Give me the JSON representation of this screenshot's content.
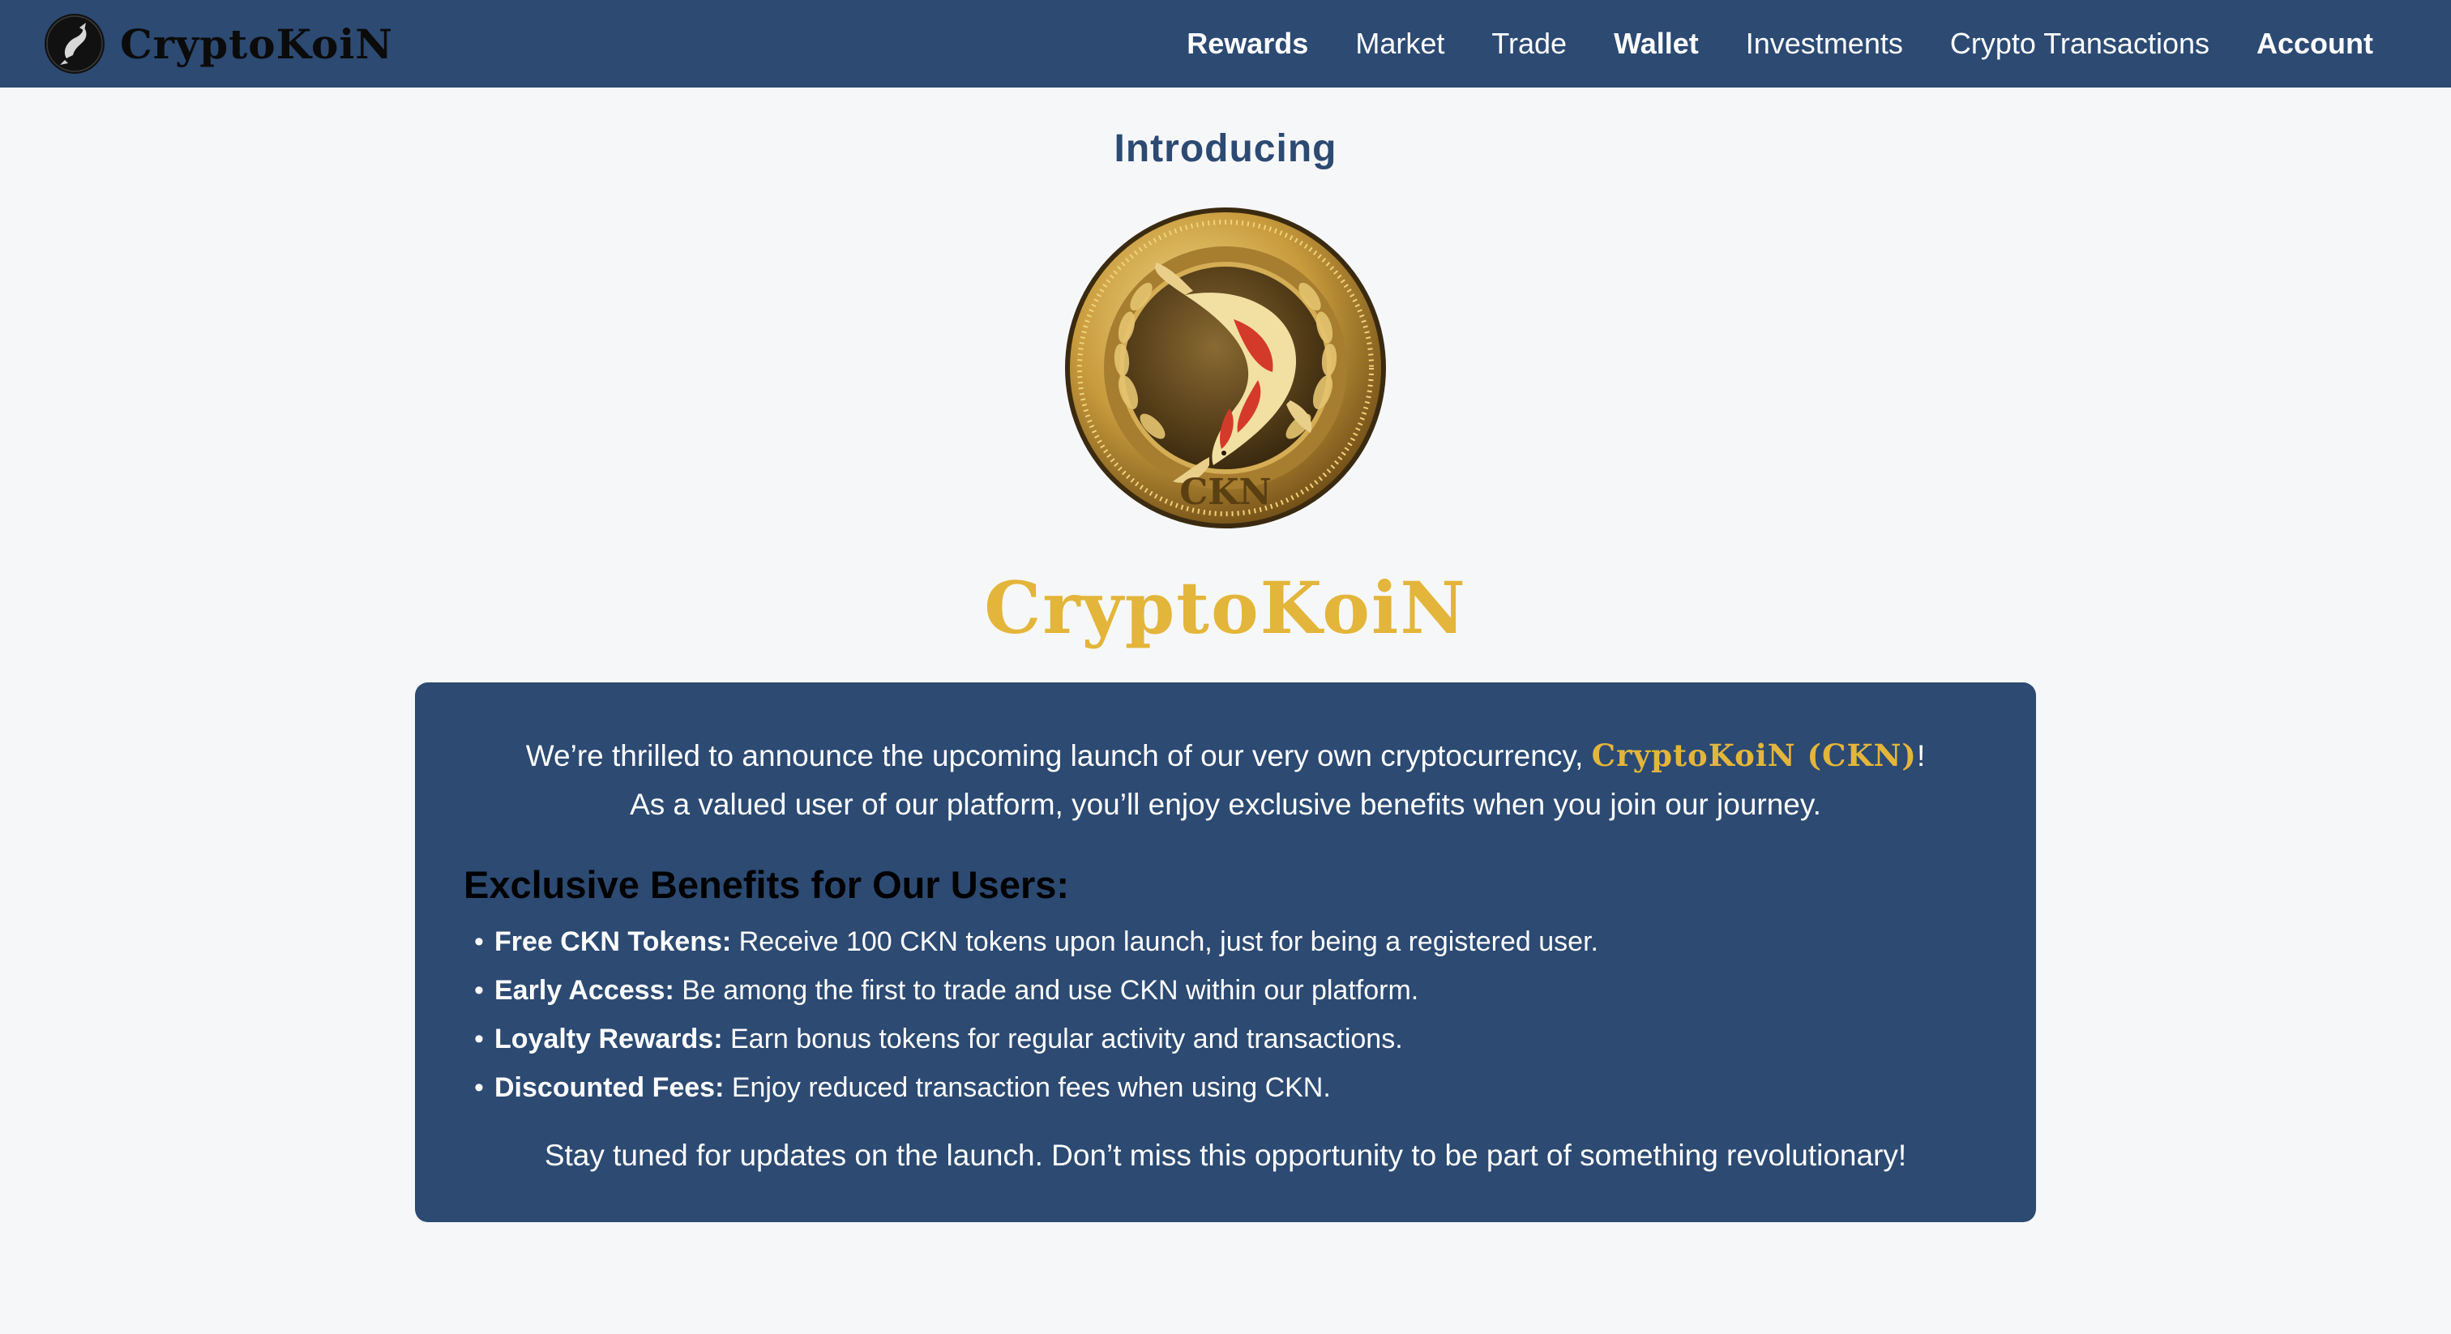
{
  "brand": {
    "name": "CryptoKoiN",
    "logo_icon": "koi-fish-logo-icon"
  },
  "nav": {
    "items": [
      {
        "label": "Rewards",
        "bold": true
      },
      {
        "label": "Market",
        "bold": false
      },
      {
        "label": "Trade",
        "bold": false
      },
      {
        "label": "Wallet",
        "bold": true
      },
      {
        "label": "Investments",
        "bold": false
      },
      {
        "label": "Crypto Transactions",
        "bold": false
      },
      {
        "label": "Account",
        "bold": true
      }
    ]
  },
  "hero": {
    "intro": "Introducing",
    "coin_icon": "ckn-koi-coin-icon",
    "coin_inscription": "CKN",
    "title": "CryptoKoiN"
  },
  "card": {
    "announce_before": "We’re thrilled to announce the upcoming launch of our very own cryptocurrency, ",
    "announce_highlight": "CryptoKoiN (CKN)",
    "announce_after": "!",
    "announce_line2": "As a valued user of our platform, you’ll enjoy exclusive benefits when you join our journey.",
    "benefits_heading": "Exclusive Benefits for Our Users:",
    "benefits": [
      {
        "title": "Free CKN Tokens:",
        "text": " Receive 100 CKN tokens upon launch, just for being a registered user."
      },
      {
        "title": "Early Access:",
        "text": " Be among the first to trade and use CKN within our platform."
      },
      {
        "title": "Loyalty Rewards:",
        "text": " Earn bonus tokens for regular activity and transactions."
      },
      {
        "title": "Discounted Fees:",
        "text": " Enjoy reduced transaction fees when using CKN."
      }
    ],
    "closing": "Stay tuned for updates on the launch. Don’t miss this opportunity to be part of something revolutionary!"
  },
  "colors": {
    "nav_bg": "#2c4a72",
    "page_bg": "#f6f7f9",
    "gold": "#e3b53a",
    "card_bg": "#2c4a72"
  }
}
